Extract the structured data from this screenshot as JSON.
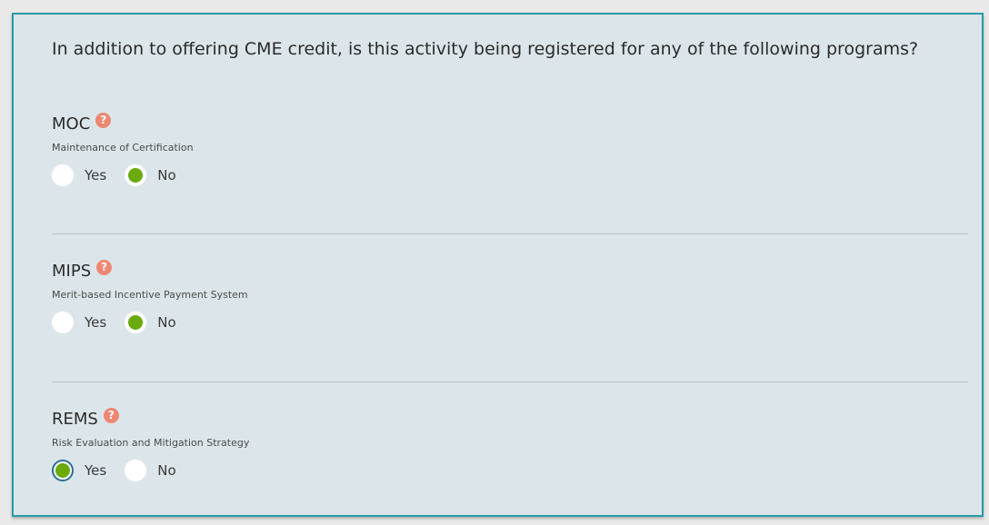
{
  "question": "In addition to offering CME credit, is this activity being registered for any of the following programs?",
  "help_glyph": "?",
  "programs": [
    {
      "title": "MOC",
      "subtitle": "Maintenance of Certification",
      "options": [
        {
          "label": "Yes",
          "selected": false
        },
        {
          "label": "No",
          "selected": true
        }
      ]
    },
    {
      "title": "MIPS",
      "subtitle": "Merit-based Incentive Payment System",
      "options": [
        {
          "label": "Yes",
          "selected": false
        },
        {
          "label": "No",
          "selected": true
        }
      ]
    },
    {
      "title": "REMS",
      "subtitle": "Risk Evaluation and Mitigation Strategy",
      "options": [
        {
          "label": "Yes",
          "selected": true,
          "focused": true
        },
        {
          "label": "No",
          "selected": false
        }
      ]
    }
  ],
  "colors": {
    "panel_bg": "#dce6ea",
    "panel_border": "#2a9aa6",
    "radio_selected": "#6aaa0c",
    "help_icon": "#ee8772",
    "focus_ring": "#2a6f93"
  }
}
